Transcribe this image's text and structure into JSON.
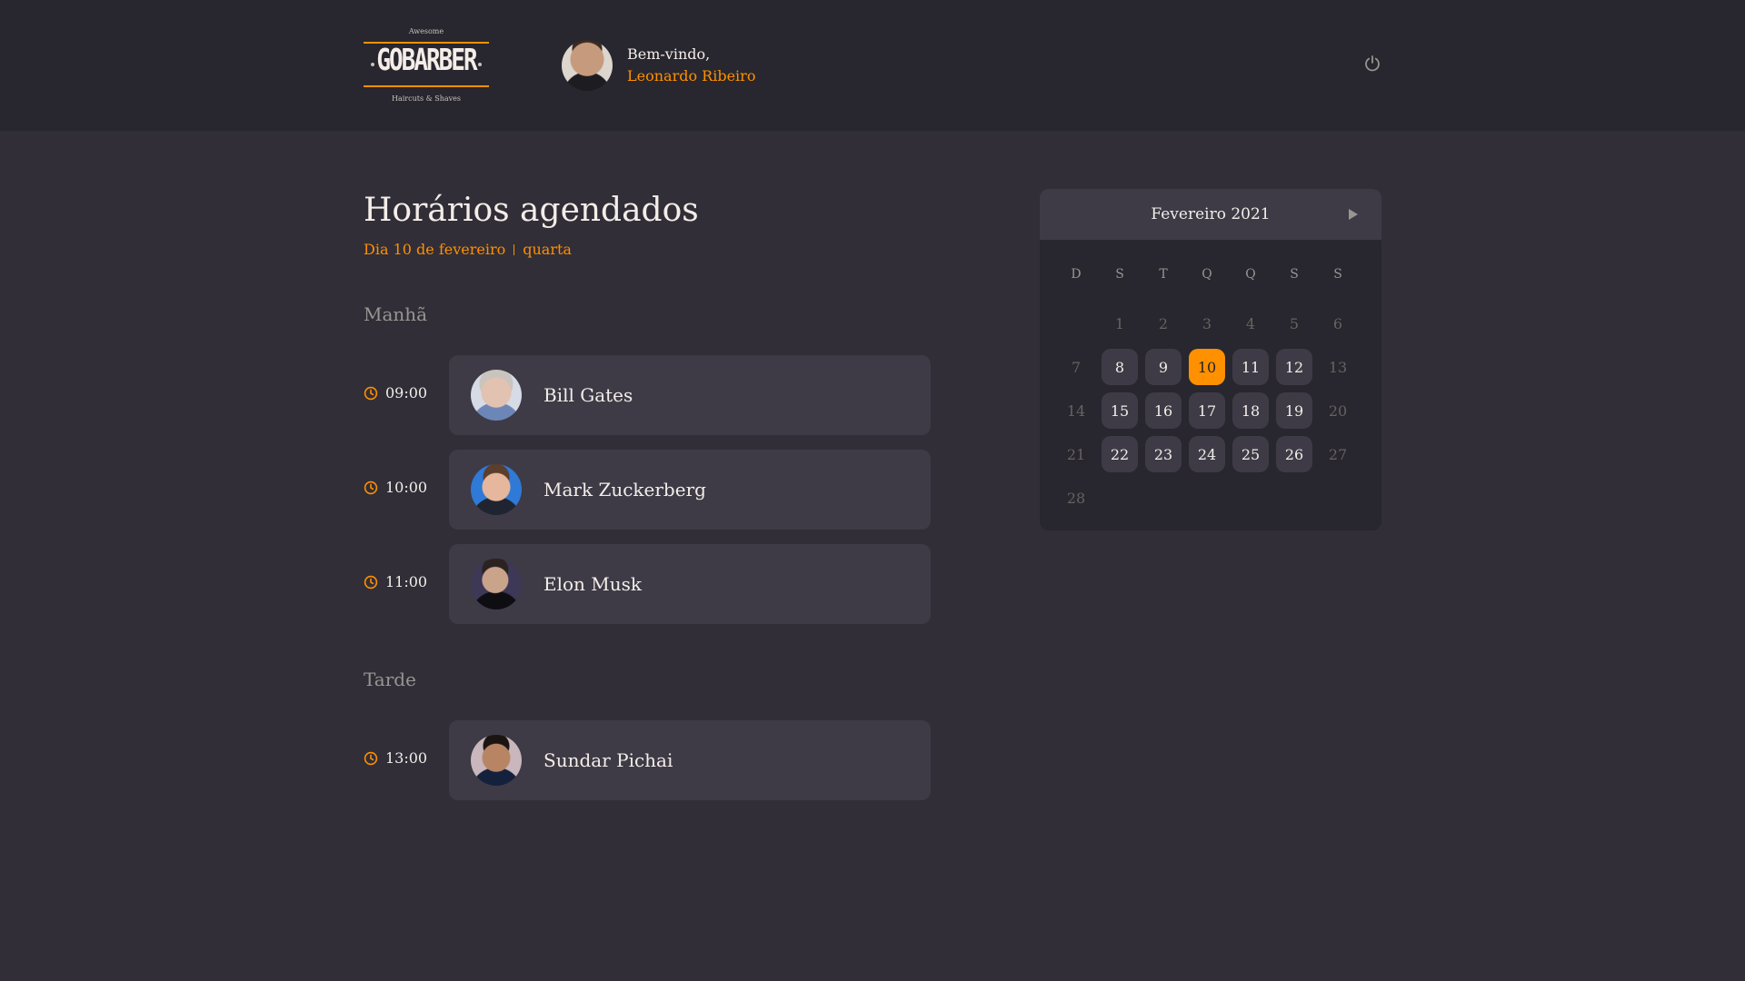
{
  "header": {
    "logo": {
      "top_text": "Awesome",
      "brand": "GOBARBER",
      "bottom_text": "Haircuts & Shaves"
    },
    "welcome_label": "Bem-vindo,",
    "user_name": "Leonardo Ribeiro",
    "logout_icon": "power-icon"
  },
  "schedule": {
    "title": "Horários agendados",
    "date_text": "Dia 10 de fevereiro",
    "weekday_text": "quarta",
    "morning": {
      "title": "Manhã",
      "appointments": [
        {
          "time": "09:00",
          "name": "Bill Gates"
        },
        {
          "time": "10:00",
          "name": "Mark Zuckerberg"
        },
        {
          "time": "11:00",
          "name": "Elon Musk"
        }
      ]
    },
    "afternoon": {
      "title": "Tarde",
      "appointments": [
        {
          "time": "13:00",
          "name": "Sundar Pichai"
        }
      ]
    }
  },
  "calendar": {
    "month_label": "Fevereiro 2021",
    "next_icon": "play-icon",
    "weekdays": [
      "D",
      "S",
      "T",
      "Q",
      "Q",
      "S",
      "S"
    ],
    "leading_empty": 1,
    "days": [
      {
        "n": "1",
        "state": "disabled"
      },
      {
        "n": "2",
        "state": "disabled"
      },
      {
        "n": "3",
        "state": "disabled"
      },
      {
        "n": "4",
        "state": "disabled"
      },
      {
        "n": "5",
        "state": "disabled"
      },
      {
        "n": "6",
        "state": "disabled"
      },
      {
        "n": "7",
        "state": "disabled"
      },
      {
        "n": "8",
        "state": "available"
      },
      {
        "n": "9",
        "state": "available"
      },
      {
        "n": "10",
        "state": "selected"
      },
      {
        "n": "11",
        "state": "available"
      },
      {
        "n": "12",
        "state": "available"
      },
      {
        "n": "13",
        "state": "disabled"
      },
      {
        "n": "14",
        "state": "disabled"
      },
      {
        "n": "15",
        "state": "available"
      },
      {
        "n": "16",
        "state": "available"
      },
      {
        "n": "17",
        "state": "available"
      },
      {
        "n": "18",
        "state": "available"
      },
      {
        "n": "19",
        "state": "available"
      },
      {
        "n": "20",
        "state": "disabled"
      },
      {
        "n": "21",
        "state": "disabled"
      },
      {
        "n": "22",
        "state": "available"
      },
      {
        "n": "23",
        "state": "available"
      },
      {
        "n": "24",
        "state": "available"
      },
      {
        "n": "25",
        "state": "available"
      },
      {
        "n": "26",
        "state": "available"
      },
      {
        "n": "27",
        "state": "disabled"
      },
      {
        "n": "28",
        "state": "disabled"
      }
    ]
  },
  "colors": {
    "accent": "#ff9000",
    "background": "#312e38",
    "header_bg": "#28262e",
    "card_bg": "#3e3b47",
    "text": "#f4ede8",
    "muted": "#999591",
    "disabled": "#666360"
  }
}
